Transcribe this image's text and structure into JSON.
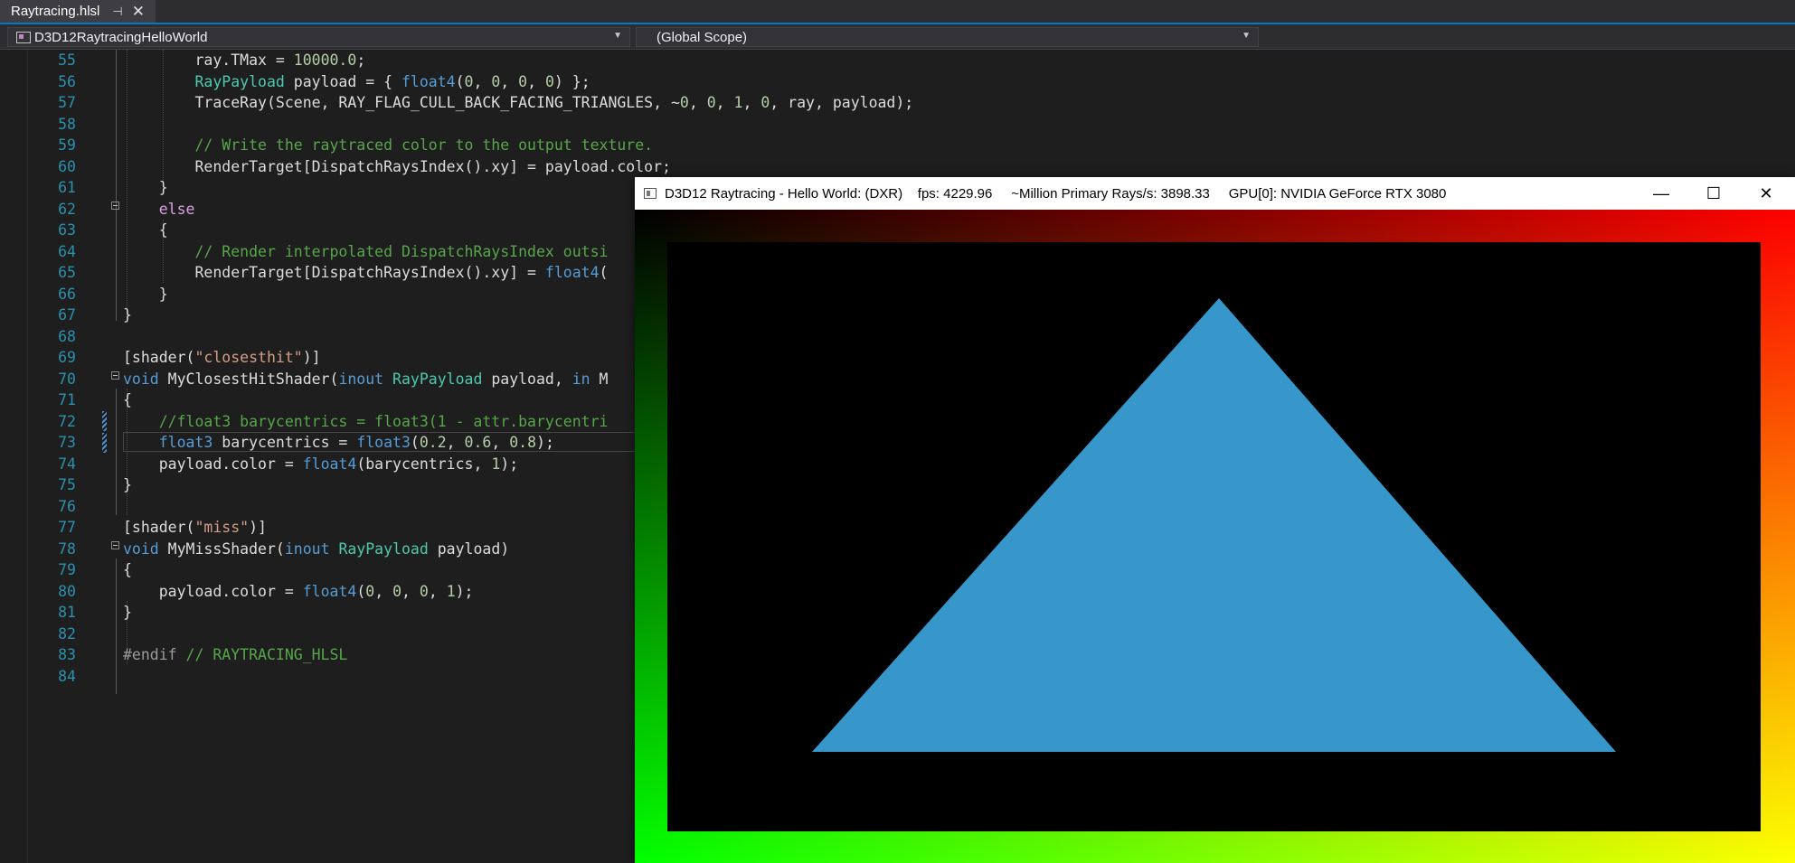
{
  "tab": {
    "title": "Raytracing.hlsl",
    "pin_glyph": "⊣",
    "close_glyph": "✕"
  },
  "navbar": {
    "project": "D3D12RaytracingHelloWorld",
    "scope": "(Global Scope)"
  },
  "code_lines": [
    {
      "n": "55",
      "html": "        <span class=\"id\">ray.TMax = </span><span class=\"nm\">10000.0</span><span class=\"id\">;</span>"
    },
    {
      "n": "56",
      "html": "        <span class=\"ty\">RayPayload</span><span class=\"id\"> payload = { </span><span class=\"kw\">float4</span><span class=\"id\">(</span><span class=\"nm\">0</span><span class=\"id\">, </span><span class=\"nm\">0</span><span class=\"id\">, </span><span class=\"nm\">0</span><span class=\"id\">, </span><span class=\"nm\">0</span><span class=\"id\">) };</span>"
    },
    {
      "n": "57",
      "html": "        <span class=\"id\">TraceRay(Scene, RAY_FLAG_CULL_BACK_FACING_TRIANGLES, ~</span><span class=\"nm\">0</span><span class=\"id\">, </span><span class=\"nm\">0</span><span class=\"id\">, </span><span class=\"nm\">1</span><span class=\"id\">, </span><span class=\"nm\">0</span><span class=\"id\">, ray, payload);</span>"
    },
    {
      "n": "58",
      "html": ""
    },
    {
      "n": "59",
      "html": "        <span class=\"cm\">// Write the raytraced color to the output texture.</span>"
    },
    {
      "n": "60",
      "html": "        <span class=\"id\">RenderTarget[DispatchRaysIndex().xy] = payload.color;</span>"
    },
    {
      "n": "61",
      "html": "    <span class=\"id\">}</span>"
    },
    {
      "n": "62",
      "html": "    <span class=\"kw2\">else</span>"
    },
    {
      "n": "63",
      "html": "    <span class=\"id\">{</span>"
    },
    {
      "n": "64",
      "html": "        <span class=\"cm\">// Render interpolated DispatchRaysIndex outsi</span>"
    },
    {
      "n": "65",
      "html": "        <span class=\"id\">RenderTarget[DispatchRaysIndex().xy] = </span><span class=\"kw\">float4</span><span class=\"id\">(</span>"
    },
    {
      "n": "66",
      "html": "    <span class=\"id\">}</span>"
    },
    {
      "n": "67",
      "html": "<span class=\"id\">}</span>"
    },
    {
      "n": "68",
      "html": ""
    },
    {
      "n": "69",
      "html": "<span class=\"id\">[shader(</span><span class=\"st\">\"closesthit\"</span><span class=\"id\">)]</span>"
    },
    {
      "n": "70",
      "html": "<span class=\"kw\">void</span><span class=\"id\"> MyClosestHitShader(</span><span class=\"kw\">inout</span><span class=\"id\"> </span><span class=\"ty\">RayPayload</span><span class=\"id\"> payload, </span><span class=\"kw\">in</span><span class=\"id\"> M</span>"
    },
    {
      "n": "71",
      "html": "<span class=\"id\">{</span>"
    },
    {
      "n": "72",
      "html": "    <span class=\"cm\">//float3 barycentrics = float3(1 - attr.barycentri</span>"
    },
    {
      "n": "73",
      "html": "    <span class=\"kw\">float3</span><span class=\"id\"> barycentrics = </span><span class=\"kw\">float3</span><span class=\"id\">(</span><span class=\"nm\">0.2</span><span class=\"id\">, </span><span class=\"nm\">0.6</span><span class=\"id\">, </span><span class=\"nm\">0.8</span><span class=\"id\">);</span>"
    },
    {
      "n": "74",
      "html": "    <span class=\"id\">payload.color = </span><span class=\"kw\">float4</span><span class=\"id\">(barycentrics, </span><span class=\"nm\">1</span><span class=\"id\">);</span>"
    },
    {
      "n": "75",
      "html": "<span class=\"id\">}</span>"
    },
    {
      "n": "76",
      "html": ""
    },
    {
      "n": "77",
      "html": "<span class=\"id\">[shader(</span><span class=\"st\">\"miss\"</span><span class=\"id\">)]</span>"
    },
    {
      "n": "78",
      "html": "<span class=\"kw\">void</span><span class=\"id\"> MyMissShader(</span><span class=\"kw\">inout</span><span class=\"id\"> </span><span class=\"ty\">RayPayload</span><span class=\"id\"> payload)</span>"
    },
    {
      "n": "79",
      "html": "<span class=\"id\">{</span>"
    },
    {
      "n": "80",
      "html": "    <span class=\"id\">payload.color = </span><span class=\"kw\">float4</span><span class=\"id\">(</span><span class=\"nm\">0</span><span class=\"id\">, </span><span class=\"nm\">0</span><span class=\"id\">, </span><span class=\"nm\">0</span><span class=\"id\">, </span><span class=\"nm\">1</span><span class=\"id\">);</span>"
    },
    {
      "n": "81",
      "html": "<span class=\"id\">}</span>"
    },
    {
      "n": "82",
      "html": ""
    },
    {
      "n": "83",
      "html": "<span class=\"pp\">#endif</span><span class=\"cm\"> // RAYTRACING_HLSL</span>"
    },
    {
      "n": "84",
      "html": ""
    }
  ],
  "app": {
    "title": "D3D12 Raytracing - Hello World: (DXR)    fps: 4229.96     ~Million Primary Rays/s: 3898.33     GPU[0]: NVIDIA GeForce RTX 3080",
    "minimize_glyph": "—",
    "maximize_glyph": "☐",
    "close_glyph": "✕",
    "triangle_color": "#3797cb",
    "viewport_color": "#000000"
  }
}
